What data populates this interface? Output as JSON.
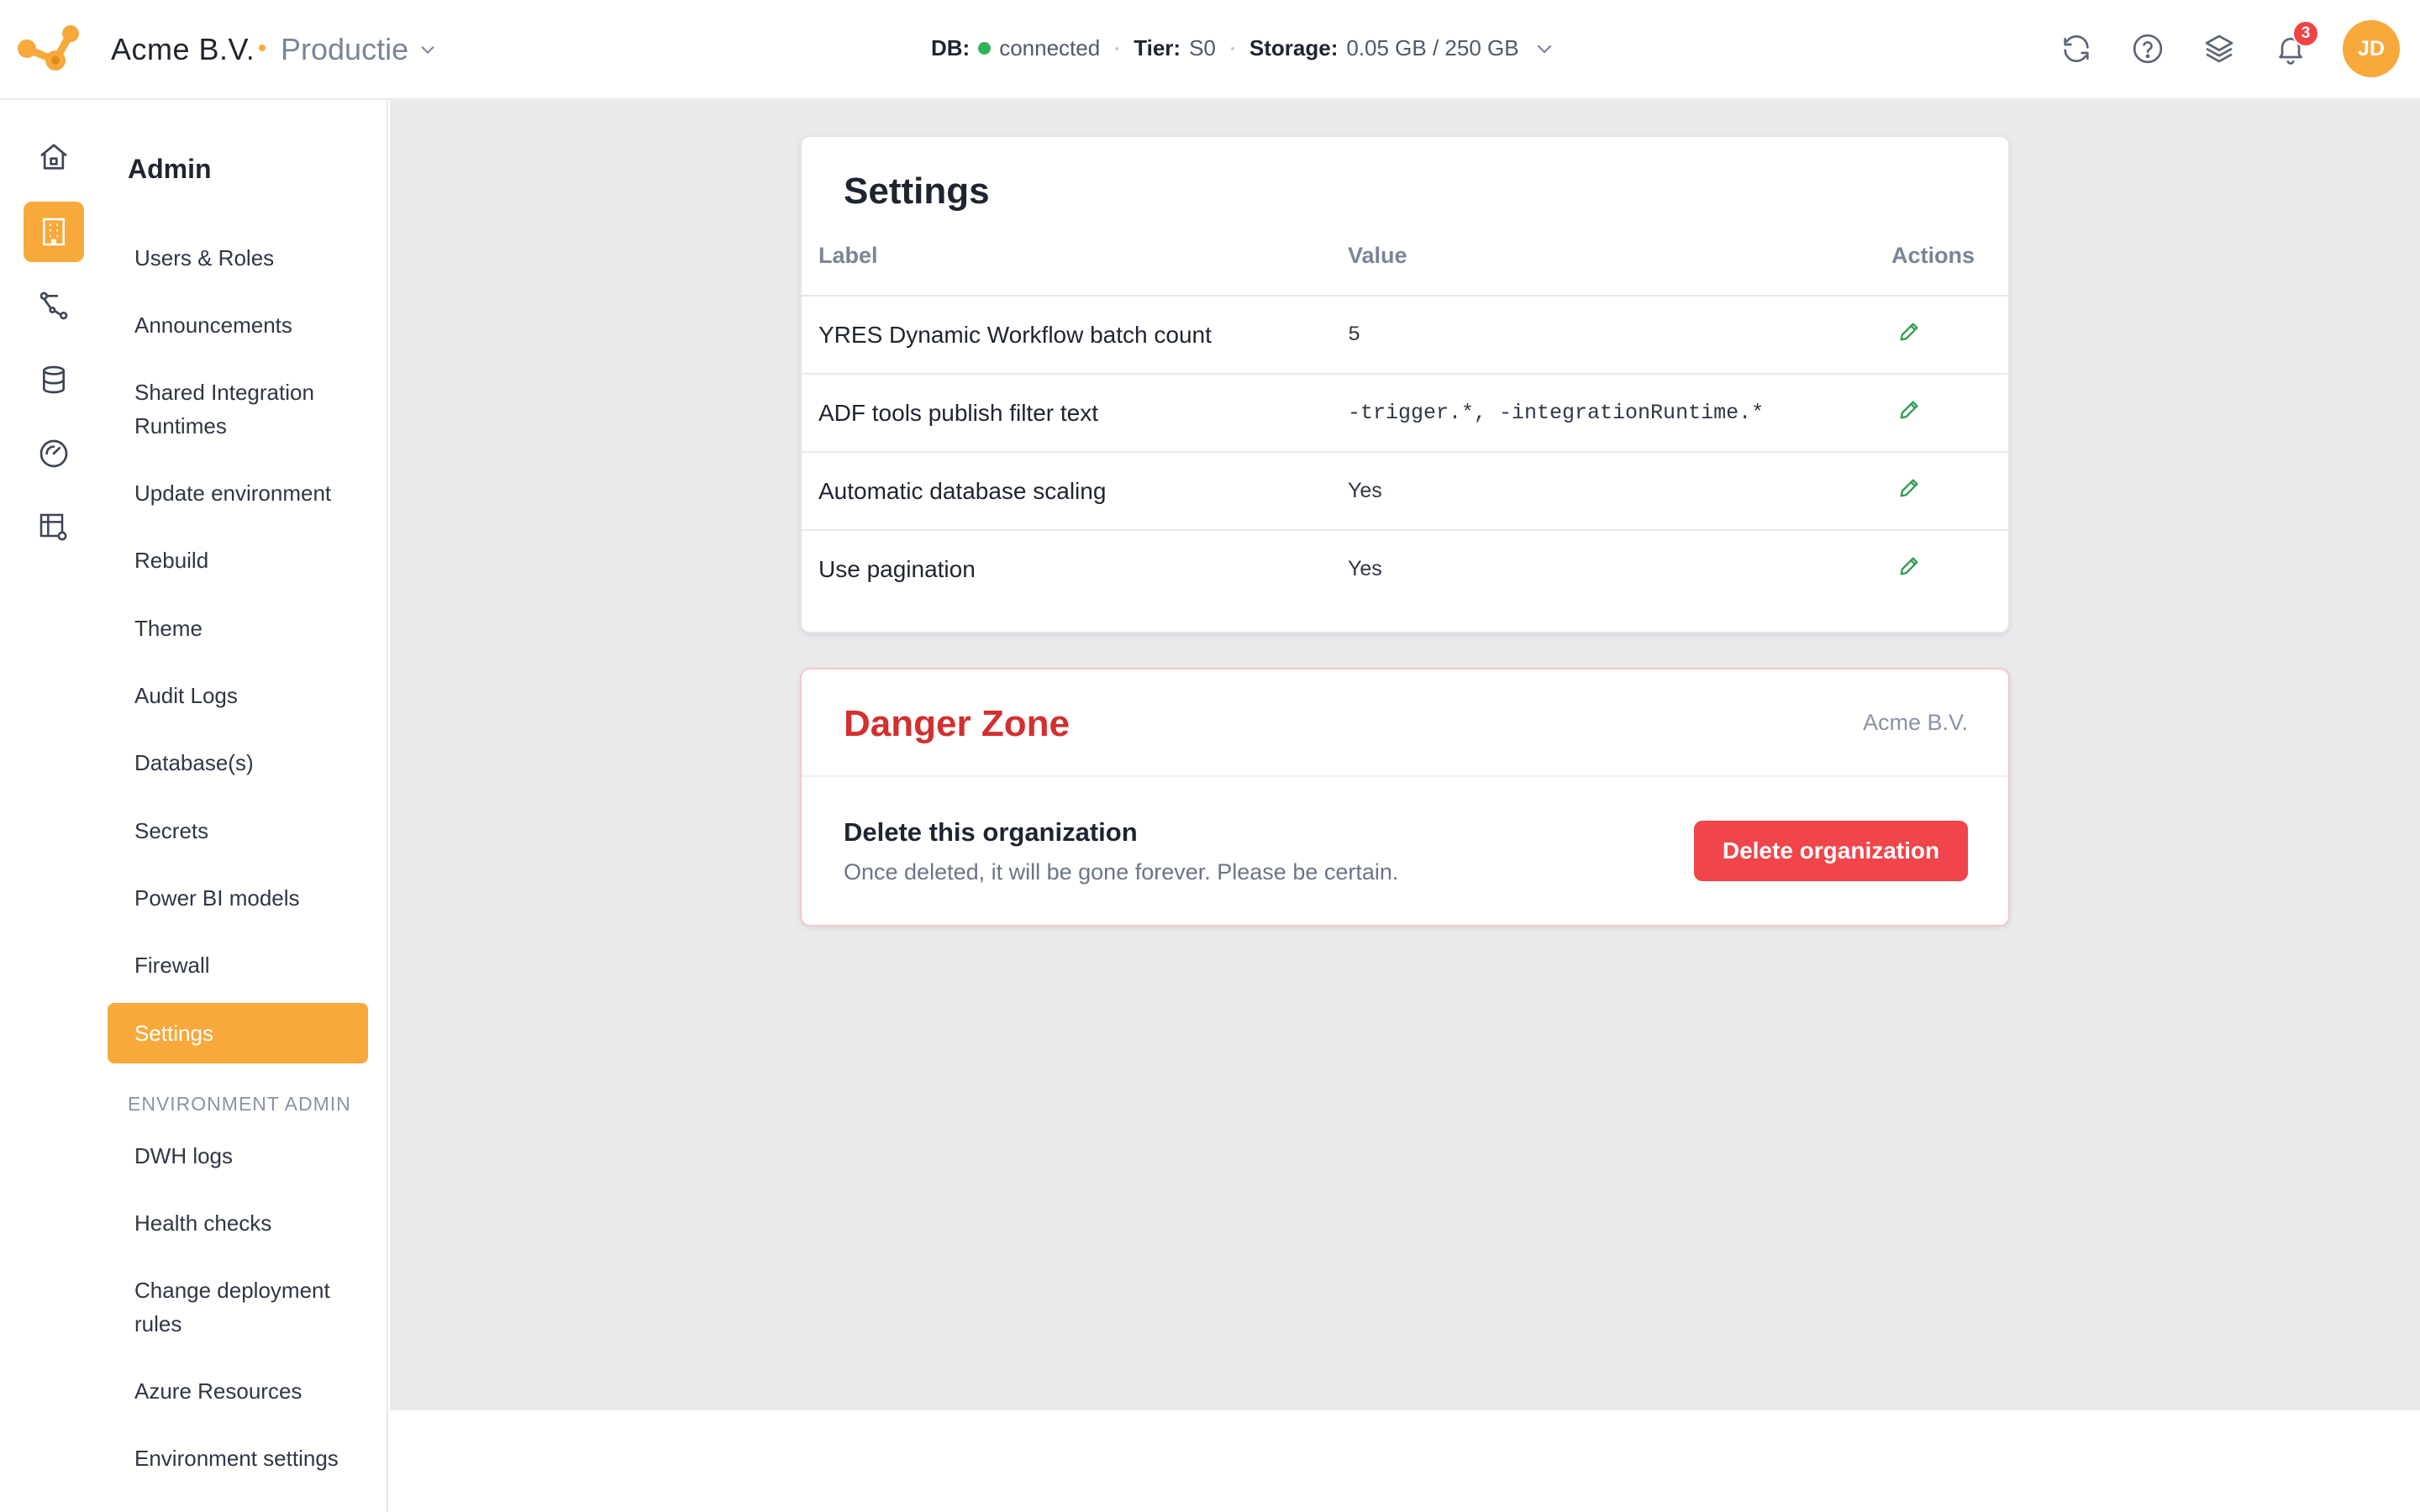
{
  "header": {
    "org_name": "Acme B.V.",
    "environment": "Productie",
    "status": {
      "db_label": "DB:",
      "db_value": "connected",
      "tier_label": "Tier:",
      "tier_value": "S0",
      "storage_label": "Storage:",
      "storage_value": "0.05 GB / 250 GB"
    },
    "notifications_count": "3",
    "avatar_initials": "JD"
  },
  "sidebar": {
    "title": "Admin",
    "items": [
      {
        "label": "Users & Roles"
      },
      {
        "label": "Announcements"
      },
      {
        "label": "Shared Integration"
      },
      {
        "label": "Runtimes"
      },
      {
        "label": "Update environment"
      },
      {
        "label": "Rebuild"
      },
      {
        "label": "Theme"
      },
      {
        "label": "Audit Logs"
      },
      {
        "label": "Database(s)"
      },
      {
        "label": "Secrets"
      },
      {
        "label": "Power BI models"
      },
      {
        "label": "Firewall"
      },
      {
        "label": "Settings"
      }
    ],
    "section_label": "ENVIRONMENT ADMIN",
    "env_items": [
      {
        "label": "DWH logs"
      },
      {
        "label": "Health checks"
      },
      {
        "label": "Change deployment"
      },
      {
        "label": "rules"
      },
      {
        "label": "Azure Resources"
      },
      {
        "label": "Environment settings"
      }
    ]
  },
  "settings": {
    "title": "Settings",
    "columns": [
      "Label",
      "Value",
      "Actions"
    ],
    "rows": [
      {
        "label": "YRES Dynamic Workflow batch count",
        "value": "5"
      },
      {
        "label": "ADF tools publish filter text",
        "value": "-trigger.*, -integrationRuntime.*"
      },
      {
        "label": "Automatic database scaling",
        "value": "Yes"
      },
      {
        "label": "Use pagination",
        "value": "Yes"
      }
    ]
  },
  "danger_zone": {
    "title": "Danger Zone",
    "org": "Acme B.V.",
    "delete_title": "Delete this organization",
    "delete_desc": "Once deleted, it will be gone forever. Please be certain.",
    "delete_button": "Delete organization"
  },
  "colors": {
    "accent": "#f7a93b",
    "danger": "#d32f2f",
    "danger_button": "#f0454a",
    "edit_icon": "#2e9d52",
    "status_ok": "#2fb35a"
  }
}
